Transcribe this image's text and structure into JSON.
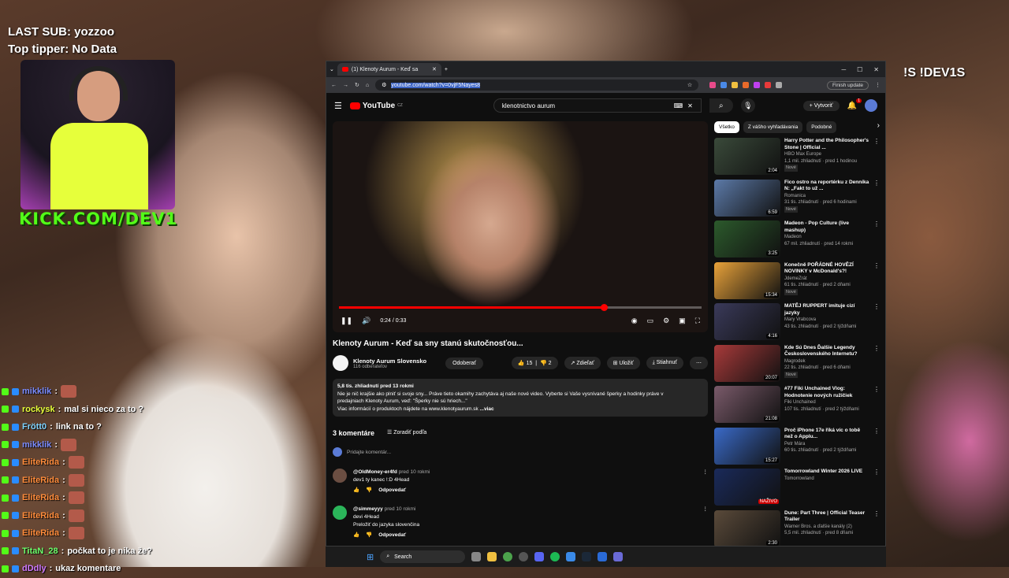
{
  "stream_overlay": {
    "last_sub": "LAST SUB: yozzoo",
    "top_tipper": "Top tipper: No Data",
    "kick_url": "KICK.COM/DEV1",
    "right_command": "!S !DEV1S"
  },
  "chat": [
    {
      "user": "mikklik",
      "color": "#7b8cff",
      "message": "",
      "emote": true
    },
    {
      "user": "rockysk",
      "color": "#e8ff3b",
      "message": "mal si nieco za to ?",
      "emote": false
    },
    {
      "user": "Frött0",
      "color": "#7fd3ff",
      "message": "link na to ?",
      "emote": false
    },
    {
      "user": "mikklik",
      "color": "#7b8cff",
      "message": "",
      "emote": true
    },
    {
      "user": "EliteRida",
      "color": "#ff8c3b",
      "message": "",
      "emote": true
    },
    {
      "user": "EliteRida",
      "color": "#ff8c3b",
      "message": "",
      "emote": true
    },
    {
      "user": "EliteRida",
      "color": "#ff8c3b",
      "message": "",
      "emote": true
    },
    {
      "user": "EliteRida",
      "color": "#ff8c3b",
      "message": "",
      "emote": true
    },
    {
      "user": "EliteRida",
      "color": "#ff8c3b",
      "message": "",
      "emote": true
    },
    {
      "user": "TitaN_28",
      "color": "#6cff6c",
      "message": "počkat to je nika že?",
      "emote": false
    },
    {
      "user": "dDdly",
      "color": "#d07aff",
      "message": "ukaz komentare",
      "emote": false
    }
  ],
  "browser": {
    "tab_title": "(1) Klenoty Aurum - Keď sa",
    "url": "youtube.com/watch?v=0vjF5Nayes8",
    "finish_update": "Finish update",
    "new_tab": "+"
  },
  "youtube": {
    "logo_text": "YouTube",
    "region": "CZ",
    "search_value": "klenotnictvo aurum",
    "create_label": "Vytvoriť",
    "notif_count": "1",
    "player": {
      "time": "0:24 / 0:33",
      "progress": 0.73
    },
    "video_title": "Klenoty Aurum - Keď sa sny stanú skutočnosťou...",
    "channel_name": "Klenoty Aurum Slovensko",
    "subscribers": "116 odberateľov",
    "subscribe_label": "Odoberať",
    "likes": "15",
    "dislikes": "2",
    "share_label": "Zdieľať",
    "save_label": "Uložiť",
    "download_label": "Stiahnuť",
    "description": {
      "meta": "5,8 tis. zhliadnutí  pred 13 rokmi",
      "line1": "Nie je nič krajšie ako plniť si svoje sny... Práve tieto okamihy zachytáva aj naše nové video. Vyberte si Vaše vysnívané šperky a hodinky práve v",
      "line2": "predajniach Klenoty Aurum, veď: \"Šperky nie sú hriech...\"",
      "line3": "Viac informácií o produktoch nájdete na www.klenotyaurum.sk",
      "more": "...viac"
    },
    "comments_count": "3 komentáre",
    "sort_label": "Zoradiť podľa",
    "add_comment_placeholder": "Pridajte komentár...",
    "comments": [
      {
        "author": "@OldMoney-er4fd",
        "time": "pred 10 rokmi",
        "text": "dev1 ty kanec !:D 4Head",
        "translate": "",
        "reply": "Odpovedať",
        "avatar_color": "#6b4e42"
      },
      {
        "author": "@simmeyyy",
        "time": "pred 10 rokmi",
        "text": "devi 4Head",
        "translate": "Preložiť do jazyka slovenčina",
        "reply": "Odpovedať",
        "avatar_color": "#2bb55a"
      }
    ],
    "chips": [
      "Všetko",
      "Z vášho vyhľadávania",
      "Podobné"
    ],
    "recommendations": [
      {
        "title": "Harry Potter and the Philosopher's Stone | Official ...",
        "channel": "HBO Max Europe",
        "meta": "1,1 mil. zhliadnutí · pred 1 hodinou",
        "badge": "Nové",
        "duration": "2:04",
        "color": "#3a4a3a"
      },
      {
        "title": "Fico ostro na reportérku z Denníka N: „Fakt to už ...",
        "channel": "Romanica",
        "meta": "31 tis. zhliadnutí · pred 6 hodinami",
        "badge": "Nové",
        "duration": "6:59",
        "color": "#5c7aa8"
      },
      {
        "title": "Madeon - Pop Culture (live mashup)",
        "channel": "Madeon",
        "meta": "67 mil. zhliadnutí · pred 14 rokmi",
        "badge": "",
        "duration": "3:25",
        "color": "#2c5a2c"
      },
      {
        "title": "Konečně POŘÁDNÉ HOVĚZÍ NOVINKY v McDonald's?!",
        "channel": "JdemeZrát",
        "meta": "61 tis. zhliadnutí · pred 2 dňami",
        "badge": "Nové",
        "duration": "15:34",
        "color": "#e8a23a"
      },
      {
        "title": "MATĚJ RUPPERT imituje cizí jazyky",
        "channel": "Mary Vrabcova",
        "meta": "43 tis. zhliadnutí · pred 2 týždňami",
        "badge": "",
        "duration": "4:16",
        "color": "#3a3a5a"
      },
      {
        "title": "Kde Sú Dnes Ďalšie Legendy Československého Internetu?",
        "channel": "Magrodek",
        "meta": "22 tis. zhliadnutí · pred 6 dňami",
        "badge": "Nové",
        "duration": "20:07",
        "color": "#a83a3a"
      },
      {
        "title": "#77 Fiki Unchained Vlog: Hodnotenie nových ružičiek",
        "channel": "Fiki Unchained",
        "meta": "107 tis. zhliadnutí · pred 2 týždňami",
        "badge": "",
        "duration": "21:08",
        "color": "#7a5a6a"
      },
      {
        "title": "Proč iPhone 17e říká víc o tobě než o Applu...",
        "channel": "Petr Mára",
        "meta": "60 tis. zhliadnutí · pred 2 týždňami",
        "badge": "",
        "duration": "15:27",
        "color": "#3a6ac8"
      },
      {
        "title": "Tomorrowland Winter 2026 LIVE",
        "channel": "Tomorrowland",
        "meta": "",
        "badge": "",
        "duration": "NAŽIVO",
        "color": "#1a2a5a"
      },
      {
        "title": "Dune: Part Three | Official Teaser Trailer",
        "channel": "Warner Bros. a ďalšie kanály (2)",
        "meta": "5,5 mil. zhliadnutí · pred 8 dňami",
        "badge": "",
        "duration": "2:30",
        "color": "#5a4a3a"
      }
    ]
  },
  "taskbar": {
    "search_label": "Search"
  }
}
